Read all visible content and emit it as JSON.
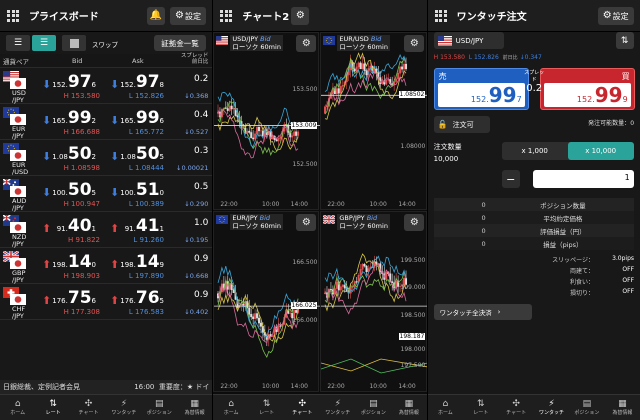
{
  "panel1": {
    "title": "プライスボード",
    "settings_label": "設定",
    "swap_label": "スワップ",
    "margin_button": "証拠金一覧",
    "columns": {
      "pair": "通貨ペア",
      "bid": "Bid",
      "ask": "Ask",
      "spread": "スプレッド",
      "change": "前日比"
    },
    "rows": [
      {
        "pair1": "USD",
        "pair2": "/JPY",
        "bid_s": "152.",
        "bid_b": "97",
        "bid_u": "6",
        "bid_h": "H 153.580",
        "ask_s": "152.",
        "ask_b": "97",
        "ask_u": "8",
        "ask_l": "L 152.826",
        "spread": "0.2",
        "change": "↓0.368",
        "dir": "dn",
        "flag": "us"
      },
      {
        "pair1": "EUR",
        "pair2": "/JPY",
        "bid_s": "165.",
        "bid_b": "99",
        "bid_u": "2",
        "bid_h": "H 166.688",
        "ask_s": "165.",
        "ask_b": "99",
        "ask_u": "6",
        "ask_l": "L 165.772",
        "spread": "0.4",
        "change": "↓0.527",
        "dir": "dn",
        "flag": "eu"
      },
      {
        "pair1": "EUR",
        "pair2": "/USD",
        "bid_s": "1.08",
        "bid_b": "50",
        "bid_u": "2",
        "bid_h": "H 1.08598",
        "ask_s": "1.08",
        "ask_b": "50",
        "ask_u": "5",
        "ask_l": "L 1.08444",
        "spread": "0.3",
        "change": "↓0.00021",
        "dir": "dn",
        "flag": "eu"
      },
      {
        "pair1": "AUD",
        "pair2": "/JPY",
        "bid_s": "100.",
        "bid_b": "50",
        "bid_u": "5",
        "bid_h": "H 100.947",
        "ask_s": "100.",
        "ask_b": "51",
        "ask_u": "0",
        "ask_l": "L 100.389",
        "spread": "0.5",
        "change": "↓0.290",
        "dir": "dn",
        "flag": "au"
      },
      {
        "pair1": "NZD",
        "pair2": "/JPY",
        "bid_s": "91.",
        "bid_b": "40",
        "bid_u": "1",
        "bid_h": "H 91.822",
        "ask_s": "91.",
        "ask_b": "41",
        "ask_u": "1",
        "ask_l": "L 91.260",
        "spread": "1.0",
        "change": "↓0.195",
        "dir": "up",
        "flag": "nz"
      },
      {
        "pair1": "GBP",
        "pair2": "/JPY",
        "bid_s": "198.",
        "bid_b": "14",
        "bid_u": "0",
        "bid_h": "H 198.903",
        "ask_s": "198.",
        "ask_b": "14",
        "ask_u": "9",
        "ask_l": "L 197.890",
        "spread": "0.9",
        "change": "↓0.668",
        "dir": "up",
        "flag": "gb"
      },
      {
        "pair1": "CHF",
        "pair2": "/JPY",
        "bid_s": "176.",
        "bid_b": "75",
        "bid_u": "6",
        "bid_h": "H 177.308",
        "ask_s": "176.",
        "ask_b": "76",
        "ask_u": "5",
        "ask_l": "L 176.583",
        "spread": "0.9",
        "change": "↓0.402",
        "dir": "up",
        "flag": "ch"
      }
    ],
    "ticker_left": "日銀総裁、定例記者会見",
    "ticker_time": "16:00",
    "ticker_right": "重要度：★ ドイ"
  },
  "panel2": {
    "title": "チャート2",
    "charts": [
      {
        "pair": "USD/JPY",
        "bid": "Bid",
        "sub": "ローソク 60min",
        "flag": "us",
        "p1": "153.500",
        "p2": "153.009",
        "p3": "152.500",
        "t1": "22:00",
        "t2": "10:00",
        "t3": "14:00"
      },
      {
        "pair": "EUR/USD",
        "bid": "Bid",
        "sub": "ローソク 60min",
        "flag": "eu",
        "p1": "1.08502",
        "p2": "1.08000",
        "t1": "22:00",
        "t2": "10:00",
        "t3": "14:00"
      },
      {
        "pair": "EUR/JPY",
        "bid": "Bid",
        "sub": "ローソク 60min",
        "flag": "eu",
        "p1": "166.500",
        "p2": "166.025",
        "p3": "166.000",
        "t1": "22:00",
        "t2": "10:00",
        "t3": "14:00"
      },
      {
        "pair": "GBP/JPY",
        "bid": "Bid",
        "sub": "ローソク 60min",
        "flag": "gb",
        "p1": "199.500",
        "p2": "199.000",
        "p3": "198.500",
        "p4": "198.187",
        "p5": "198.000",
        "p6": "197.500",
        "t1": "22:00",
        "t2": "10:00",
        "t3": "14:00"
      }
    ]
  },
  "panel3": {
    "title": "ワンタッチ注文",
    "settings_label": "設定",
    "pair": "USD/JPY",
    "high": "H 153.580",
    "low": "L 152.826",
    "prev_label": "前日比",
    "prev": "↓0.347",
    "sell_label": "売",
    "buy_label": "買",
    "spread_label": "スプレッド",
    "spread": "0.2",
    "sell_s": "152.",
    "sell_b": "99",
    "sell_u": "7",
    "buy_s": "152.",
    "buy_b": "99",
    "buy_u": "9",
    "order_ok": "注文可",
    "order_count_label": "発注可能数量：",
    "order_count": "0",
    "qty_label": "注文数量",
    "qty_value": "10,000",
    "mult1": "x 1,000",
    "mult2": "x 10,000",
    "qty_input": "1",
    "stats": [
      {
        "v": "0",
        "k": "ポジション数量"
      },
      {
        "v": "0",
        "k": "平均約定価格"
      },
      {
        "v": "0",
        "k": "評価損益（円）"
      },
      {
        "v": "0",
        "k": "損益（pips）"
      }
    ],
    "options": [
      {
        "k": "スリッページ：",
        "v": "3.0pips"
      },
      {
        "k": "両建て：",
        "v": "OFF"
      },
      {
        "k": "利食い：",
        "v": "OFF"
      },
      {
        "k": "損切り：",
        "v": "OFF"
      }
    ],
    "close_all": "ワンタッチ全決済"
  },
  "tabs": [
    "ホーム",
    "レート",
    "チャート",
    "ワンタッチ",
    "ポジション",
    "為替情報"
  ],
  "tab_icons": [
    "⌂",
    "⇅",
    "✣",
    "⚡",
    "▤",
    "▦"
  ]
}
